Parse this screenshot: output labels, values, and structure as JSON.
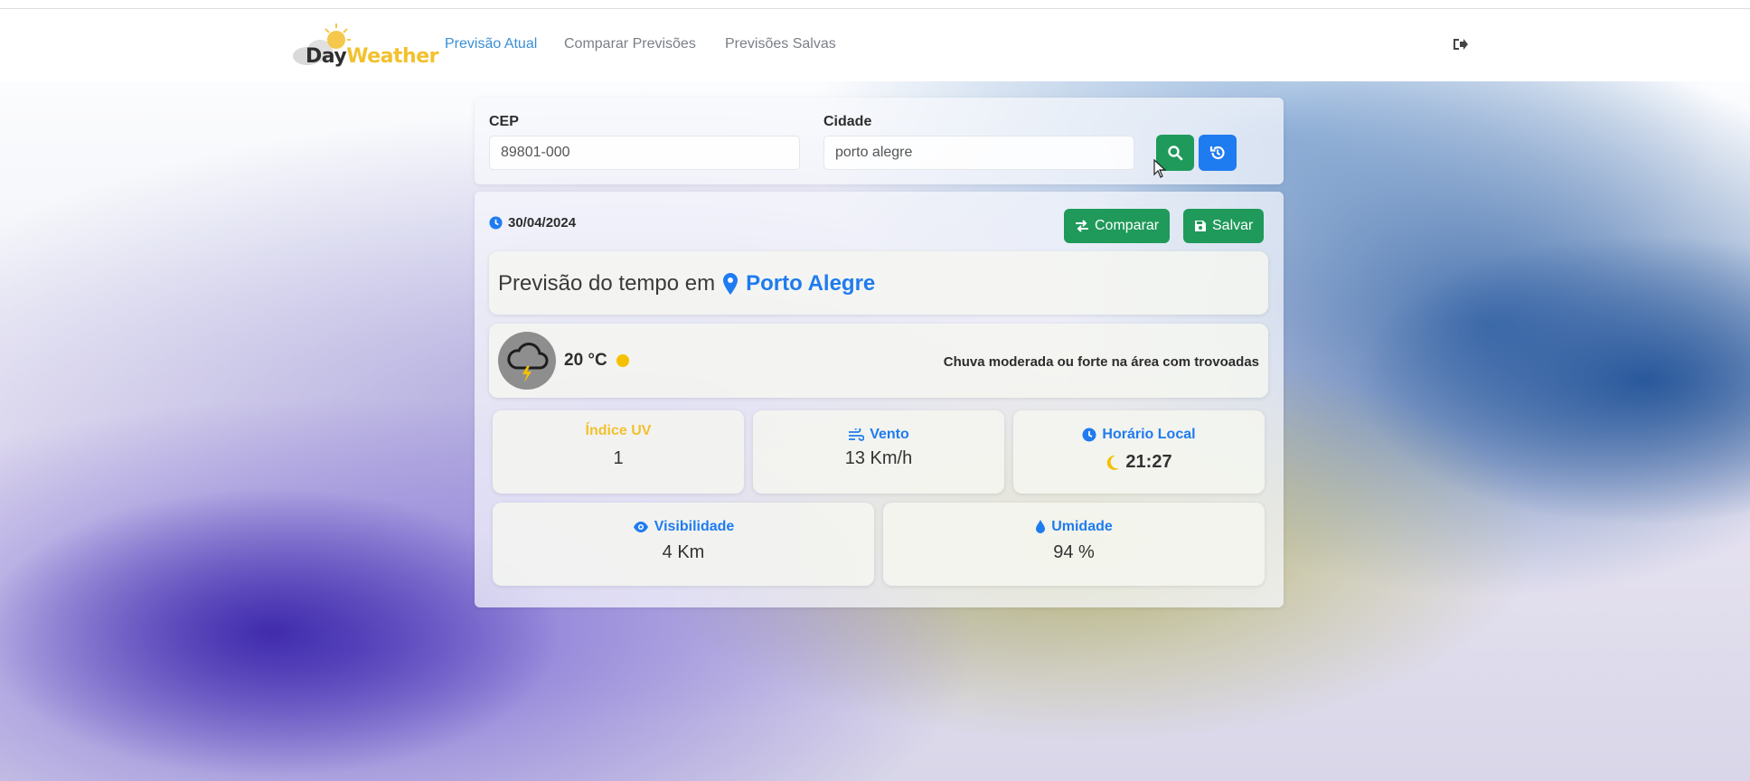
{
  "brand": {
    "logo_part1": "Day",
    "logo_part2": "Weather"
  },
  "nav": {
    "items": [
      {
        "label": "Previsão Atual",
        "active": true
      },
      {
        "label": "Comparar Previsões",
        "active": false
      },
      {
        "label": "Previsões Salvas",
        "active": false
      }
    ],
    "logout_icon": "sign-out-icon"
  },
  "search": {
    "cep_label": "CEP",
    "cep_value": "89801-000",
    "city_label": "Cidade",
    "city_value": "porto alegre",
    "search_icon": "search-icon",
    "history_icon": "history-icon"
  },
  "forecast": {
    "date": "30/04/2024",
    "compare_label": "Comparar",
    "save_label": "Salvar",
    "title_prefix": "Previsão do tempo em",
    "city": "Porto Alegre",
    "temperature": "20 °C",
    "condition": "Chuva moderada ou forte na área com trovoadas",
    "stats": {
      "uv_label": "Índice UV",
      "uv_value": "1",
      "wind_label": "Vento",
      "wind_value": "13 Km/h",
      "local_time_label": "Horário Local",
      "local_time_value": "21:27",
      "visibility_label": "Visibilidade",
      "visibility_value": "4 Km",
      "humidity_label": "Umidade",
      "humidity_value": "94 %"
    }
  },
  "colors": {
    "accent_blue": "#1f7bf0",
    "accent_green": "#1f9a5a",
    "uv_yellow": "#f2c12e"
  }
}
